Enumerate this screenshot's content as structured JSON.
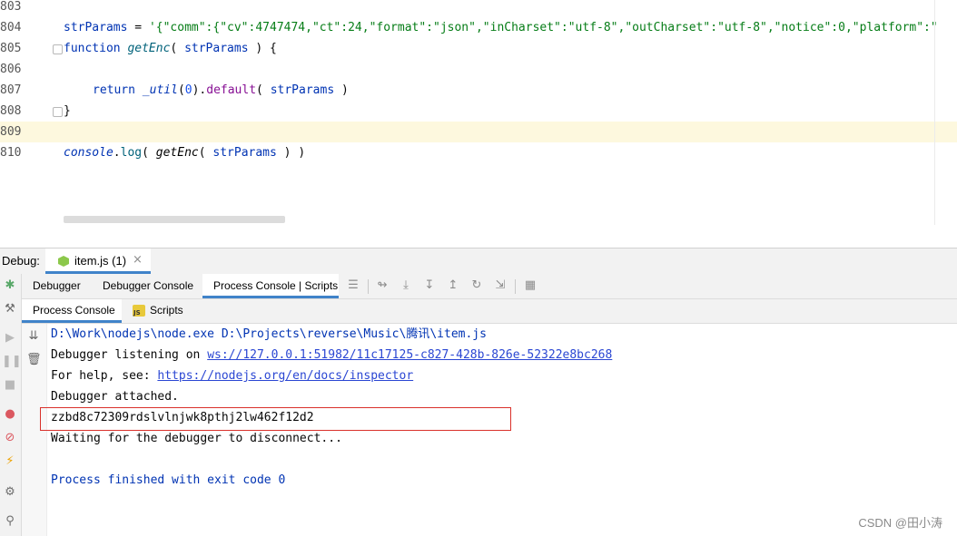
{
  "editor": {
    "lines": [
      {
        "num": "803"
      },
      {
        "num": "804"
      },
      {
        "num": "805"
      },
      {
        "num": "806"
      },
      {
        "num": "807"
      },
      {
        "num": "808"
      },
      {
        "num": "809"
      },
      {
        "num": "810"
      }
    ],
    "code": {
      "l804_var": "strParams",
      "l804_eq": " = ",
      "l804_str": "'{\"comm\":{\"cv\":4747474,\"ct\":24,\"format\":\"json\",\"inCharset\":\"utf-8\",\"outCharset\":\"utf-8\",\"notice\":0,\"platform\":\"",
      "l805_kw": "function ",
      "l805_fn": "getEnc",
      "l805_open": "( ",
      "l805_param": "strParams",
      "l805_close": " ) {",
      "l807_kw": "return ",
      "l807_util": "_util",
      "l807_call": "(",
      "l807_num": "0",
      "l807_dot": ").",
      "l807_dflt": "default",
      "l807_open": "( ",
      "l807_param": "strParams",
      "l807_close": " )",
      "l808_brace": "}",
      "l810_console": "console",
      "l810_dot": ".",
      "l810_log": "log",
      "l810_open": "( ",
      "l810_fn": "getEnc",
      "l810_open2": "( ",
      "l810_param": "strParams",
      "l810_close": " ) )"
    }
  },
  "debug": {
    "label": "Debug:",
    "run_tab": "item.js (1)",
    "close": "×",
    "tabs": {
      "debugger": "Debugger",
      "debugger_console": "Debugger Console",
      "process_console_scripts": "Process Console | Scripts"
    },
    "subtabs": {
      "process_console": "Process Console",
      "scripts": "Scripts"
    },
    "js_badge": "JS"
  },
  "console": {
    "cmd": "D:\\Work\\nodejs\\node.exe D:\\Projects\\reverse\\Music\\腾讯\\item.js",
    "listening_prefix": "Debugger listening on ",
    "listening_link": "ws://127.0.0.1:51982/11c17125-c827-428b-826e-52322e8bc268",
    "help_prefix": "For help, see: ",
    "help_link": "https://nodejs.org/en/docs/inspector",
    "attached": "Debugger attached.",
    "result": "zzbd8c72309rdslvlnjwk8pthj2lw462f12d2",
    "waiting": "Waiting for the debugger to disconnect...",
    "finished": "Process finished with exit code 0"
  },
  "watermark": "CSDN @田小涛",
  "colors": {
    "accent": "#4083c9",
    "highlight": "#d9312b",
    "current_line": "#fdf8de"
  }
}
